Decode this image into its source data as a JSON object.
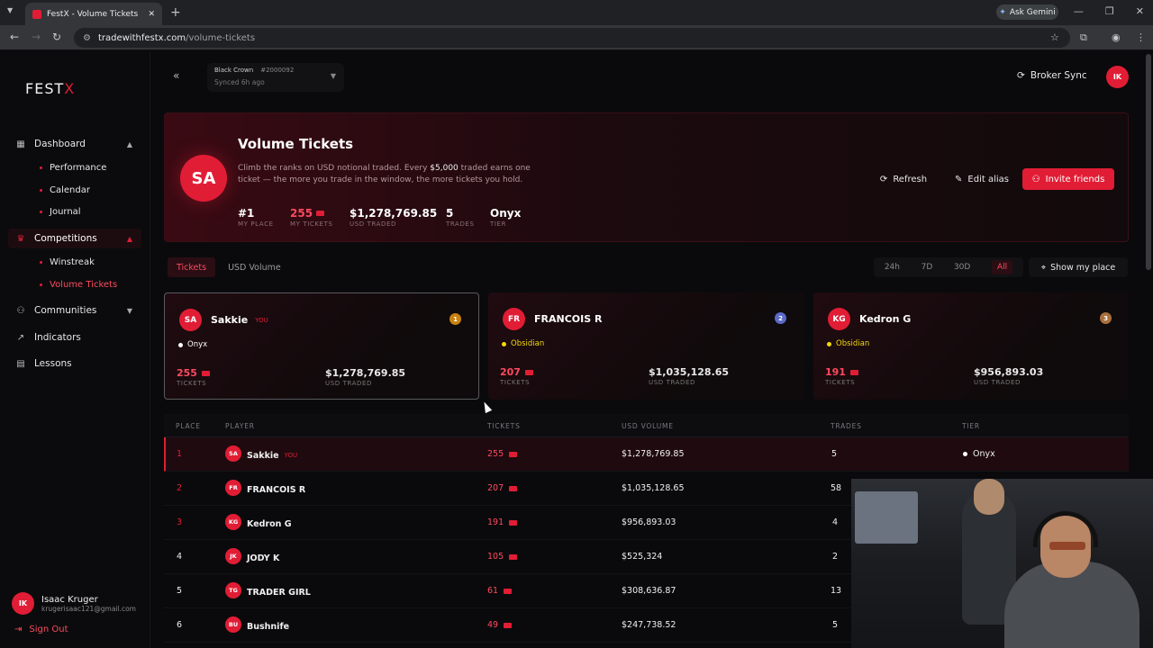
{
  "browser": {
    "tab_title": "FestX - Volume Tickets",
    "url_host": "tradewithfestx.com",
    "url_path": "/volume-tickets",
    "ask_gemini": "Ask Gemini"
  },
  "sidebar": {
    "logo_main": "FEST",
    "logo_x": "X",
    "items": [
      {
        "label": "Dashboard",
        "icon": "grid-icon"
      },
      {
        "label": "Performance"
      },
      {
        "label": "Calendar"
      },
      {
        "label": "Journal"
      },
      {
        "label": "Competitions",
        "icon": "trophy-icon"
      },
      {
        "label": "Winstreak"
      },
      {
        "label": "Volume Tickets"
      },
      {
        "label": "Communities",
        "icon": "people-icon"
      },
      {
        "label": "Indicators",
        "icon": "chart-icon"
      },
      {
        "label": "Lessons",
        "icon": "book-icon"
      }
    ],
    "user": {
      "initials": "IK",
      "name": "Isaac Kruger",
      "email": "krugerisaac121@gmail.com"
    },
    "sign_out": "Sign Out"
  },
  "topbar": {
    "account_brand": "Black Crown",
    "account_number": "#2000092",
    "synced": "Synced 6h ago",
    "broker_sync": "Broker Sync",
    "user_initials": "IK"
  },
  "hero": {
    "initials": "SA",
    "title": "Volume Tickets",
    "desc_1": "Climb the ranks on USD notional traded. Every ",
    "desc_amount": "$5,000",
    "desc_2": " traded earns one ticket — the more you trade in the window, the more tickets you hold.",
    "stats": [
      {
        "value": "#1",
        "label": "MY PLACE"
      },
      {
        "value": "255",
        "label": "MY TICKETS"
      },
      {
        "value": "$1,278,769.85",
        "label": "USD TRADED"
      },
      {
        "value": "5",
        "label": "TRADES"
      },
      {
        "value": "Onyx",
        "label": "TIER"
      }
    ],
    "refresh": "Refresh",
    "edit_alias": "Edit alias",
    "invite": "Invite friends"
  },
  "tabs": {
    "tickets": "Tickets",
    "usd_volume": "USD Volume"
  },
  "ranges": [
    "24h",
    "7D",
    "30D",
    "All"
  ],
  "show_my_place": "Show my place",
  "podium": [
    {
      "initials": "SA",
      "name": "Sakkie",
      "you": "YOU",
      "rank": "1",
      "tier": "Onyx",
      "tier_color": "#ffffff",
      "tickets": "255",
      "usd": "$1,278,769.85",
      "tickets_label": "TICKETS",
      "usd_label": "USD TRADED"
    },
    {
      "initials": "FR",
      "name": "FRANCOIS R",
      "you": "",
      "rank": "2",
      "tier": "Obsidian",
      "tier_color": "#f5d90a",
      "tickets": "207",
      "usd": "$1,035,128.65",
      "tickets_label": "TICKETS",
      "usd_label": "USD TRADED"
    },
    {
      "initials": "KG",
      "name": "Kedron G",
      "you": "",
      "rank": "3",
      "tier": "Obsidian",
      "tier_color": "#f5d90a",
      "tickets": "191",
      "usd": "$956,893.03",
      "tickets_label": "TICKETS",
      "usd_label": "USD TRADED"
    }
  ],
  "table": {
    "headers": [
      "PLACE",
      "PLAYER",
      "TICKETS",
      "USD VOLUME",
      "TRADES",
      "TIER"
    ],
    "rows": [
      {
        "place": "1",
        "initials": "SA",
        "name": "Sakkie",
        "you": "YOU",
        "tickets": "255",
        "usd": "$1,278,769.85",
        "trades": "5",
        "tier": "Onyx"
      },
      {
        "place": "2",
        "initials": "FR",
        "name": "FRANCOIS R",
        "you": "",
        "tickets": "207",
        "usd": "$1,035,128.65",
        "trades": "58",
        "tier": ""
      },
      {
        "place": "3",
        "initials": "KG",
        "name": "Kedron G",
        "you": "",
        "tickets": "191",
        "usd": "$956,893.03",
        "trades": "4",
        "tier": ""
      },
      {
        "place": "4",
        "initials": "JK",
        "name": "JODY K",
        "you": "",
        "tickets": "105",
        "usd": "$525,324",
        "trades": "2",
        "tier": ""
      },
      {
        "place": "5",
        "initials": "TG",
        "name": "TRADER GIRL",
        "you": "",
        "tickets": "61",
        "usd": "$308,636.87",
        "trades": "13",
        "tier": ""
      },
      {
        "place": "6",
        "initials": "BU",
        "name": "Bushnife",
        "you": "",
        "tickets": "49",
        "usd": "$247,738.52",
        "trades": "5",
        "tier": ""
      }
    ]
  }
}
